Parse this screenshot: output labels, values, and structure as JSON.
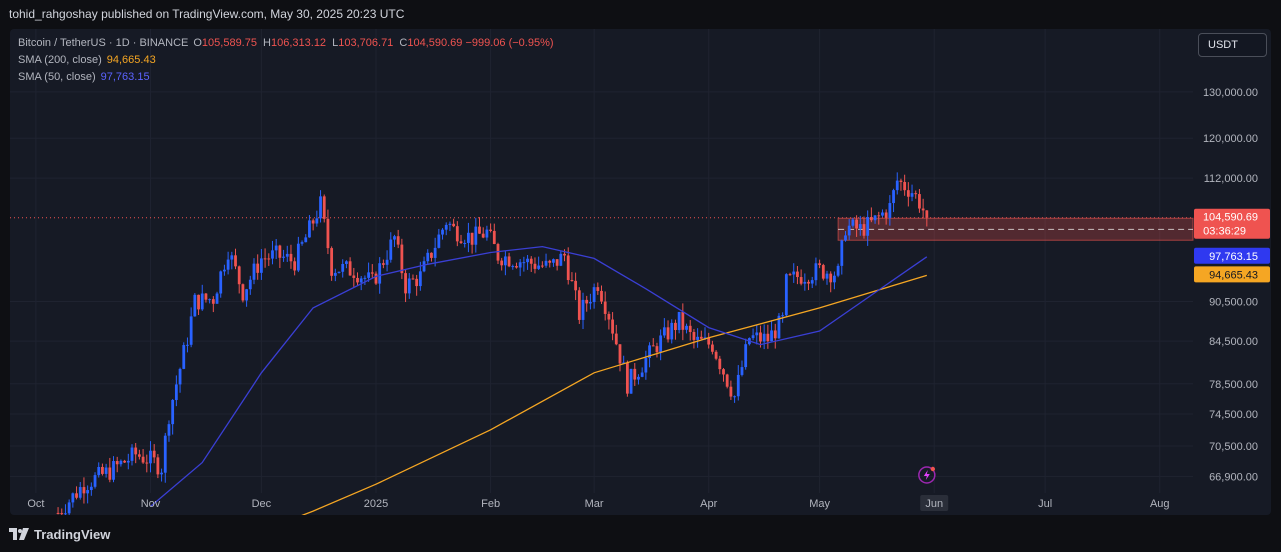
{
  "header": {
    "publisher_line": "tohid_rahgoshay published on TradingView.com, May 30, 2025 20:23 UTC"
  },
  "legend": {
    "symbol": "Bitcoin / TetherUS · 1D · BINANCE",
    "open_key": "O",
    "open_value": "105,589.75",
    "high_key": "H",
    "high_value": "106,313.12",
    "low_key": "L",
    "low_value": "103,706.71",
    "close_key": "C",
    "close_value": "104,590.69",
    "change": "−999.06 (−0.95%)",
    "sma200_label": "SMA (200, close)",
    "sma200_value": "94,665.43",
    "sma50_label": "SMA (50, close)",
    "sma50_value": "97,763.15"
  },
  "toolbar": {
    "currency": "USDT"
  },
  "footer": {
    "brand": "TradingView"
  },
  "colors": {
    "up": "#2962ff",
    "down": "#ef5350",
    "sma200": "#f5a623",
    "sma50": "#3a3fd4",
    "zone": "#ef5350",
    "background": "#161a25",
    "grid": "#1f2330"
  },
  "chart_data": {
    "type": "candlestick",
    "symbol": "Bitcoin / TetherUS",
    "interval": "1D",
    "exchange": "BINANCE",
    "y_scale": "log",
    "y_ticks": [
      130000,
      120000,
      112000,
      90500,
      84500,
      78500,
      74500,
      70500,
      66900
    ],
    "y_tick_labels": [
      "130,000.00",
      "120,000.00",
      "112,000.00",
      "90,500.00",
      "84,500.00",
      "78,500.00",
      "74,500.00",
      "70,500.00",
      "66,900.00"
    ],
    "x_ticks": [
      "Oct",
      "Nov",
      "Dec",
      "2025",
      "Feb",
      "Mar",
      "Apr",
      "May",
      "Jun",
      "Jul",
      "Aug"
    ],
    "x_tick_dates": [
      "2024-10-01",
      "2024-11-01",
      "2024-12-01",
      "2025-01-01",
      "2025-02-01",
      "2025-03-01",
      "2025-04-01",
      "2025-05-01",
      "2025-06-01",
      "2025-07-01",
      "2025-08-01"
    ],
    "x_range": [
      "2024-09-24",
      "2025-08-10"
    ],
    "y_range": [
      65000,
      140000
    ],
    "last_price": {
      "value": 104590.69,
      "label": "104,590.69",
      "countdown": "03:36:29"
    },
    "sma50_badge": {
      "value": 97763.15,
      "label": "97,763.15"
    },
    "sma200_badge": {
      "value": 94665.43,
      "label": "94,665.43"
    },
    "current_tick_label": "Jun",
    "zone": {
      "from": "2025-05-06",
      "to": "2025-08-10",
      "low": 100600,
      "high": 104500,
      "mid": 102500
    },
    "close_path": [
      [
        "2024-10-07",
        62800
      ],
      [
        "2024-10-14",
        66000
      ],
      [
        "2024-10-21",
        67500
      ],
      [
        "2024-10-28",
        69500
      ],
      [
        "2024-11-01",
        68800
      ],
      [
        "2024-11-04",
        68000
      ],
      [
        "2024-11-06",
        74500
      ],
      [
        "2024-11-11",
        85000
      ],
      [
        "2024-11-13",
        90500
      ],
      [
        "2024-11-18",
        91000
      ],
      [
        "2024-11-22",
        99000
      ],
      [
        "2024-11-26",
        92000
      ],
      [
        "2024-12-01",
        97500
      ],
      [
        "2024-12-05",
        98000
      ],
      [
        "2024-12-10",
        97000
      ],
      [
        "2024-12-13",
        101000
      ],
      [
        "2024-12-17",
        107000
      ],
      [
        "2024-12-20",
        96000
      ],
      [
        "2024-12-26",
        95500
      ],
      [
        "2024-12-31",
        93500
      ],
      [
        "2025-01-06",
        101000
      ],
      [
        "2025-01-09",
        93000
      ],
      [
        "2025-01-13",
        94500
      ],
      [
        "2025-01-20",
        104000
      ],
      [
        "2025-01-22",
        102500
      ],
      [
        "2025-01-27",
        101000
      ],
      [
        "2025-01-31",
        102000
      ],
      [
        "2025-02-03",
        98000
      ],
      [
        "2025-02-10",
        97000
      ],
      [
        "2025-02-17",
        96000
      ],
      [
        "2025-02-21",
        98000
      ],
      [
        "2025-02-25",
        88500
      ],
      [
        "2025-03-02",
        93500
      ],
      [
        "2025-03-05",
        88500
      ],
      [
        "2025-03-10",
        78500
      ],
      [
        "2025-03-18",
        84000
      ],
      [
        "2025-03-24",
        87500
      ],
      [
        "2025-03-28",
        84500
      ],
      [
        "2025-04-02",
        84000
      ],
      [
        "2025-04-06",
        79000
      ],
      [
        "2025-04-08",
        76800
      ],
      [
        "2025-04-12",
        85000
      ],
      [
        "2025-04-17",
        84800
      ],
      [
        "2025-04-21",
        87500
      ],
      [
        "2025-04-22",
        93500
      ],
      [
        "2025-04-25",
        94500
      ],
      [
        "2025-05-01",
        95500
      ],
      [
        "2025-05-06",
        95000
      ],
      [
        "2025-05-08",
        103000
      ],
      [
        "2025-05-12",
        102500
      ],
      [
        "2025-05-15",
        103500
      ],
      [
        "2025-05-20",
        106500
      ],
      [
        "2025-05-22",
        111500
      ],
      [
        "2025-05-26",
        109500
      ],
      [
        "2025-05-28",
        107500
      ],
      [
        "2025-05-30",
        104590
      ]
    ],
    "sma50_path": [
      [
        "2024-11-01",
        63500
      ],
      [
        "2024-11-15",
        68500
      ],
      [
        "2024-12-01",
        80000
      ],
      [
        "2024-12-15",
        89500
      ],
      [
        "2025-01-01",
        94500
      ],
      [
        "2025-01-15",
        96500
      ],
      [
        "2025-02-01",
        98500
      ],
      [
        "2025-02-15",
        99500
      ],
      [
        "2025-03-01",
        97500
      ],
      [
        "2025-03-15",
        92500
      ],
      [
        "2025-04-01",
        86500
      ],
      [
        "2025-04-15",
        84000
      ],
      [
        "2025-05-01",
        86000
      ],
      [
        "2025-05-15",
        91500
      ],
      [
        "2025-05-30",
        97763
      ]
    ],
    "sma200_path": [
      [
        "2024-11-22",
        59500
      ],
      [
        "2024-12-15",
        63000
      ],
      [
        "2025-01-01",
        66000
      ],
      [
        "2025-02-01",
        72500
      ],
      [
        "2025-03-01",
        80000
      ],
      [
        "2025-04-01",
        85000
      ],
      [
        "2025-05-01",
        89500
      ],
      [
        "2025-05-30",
        94665
      ]
    ]
  }
}
